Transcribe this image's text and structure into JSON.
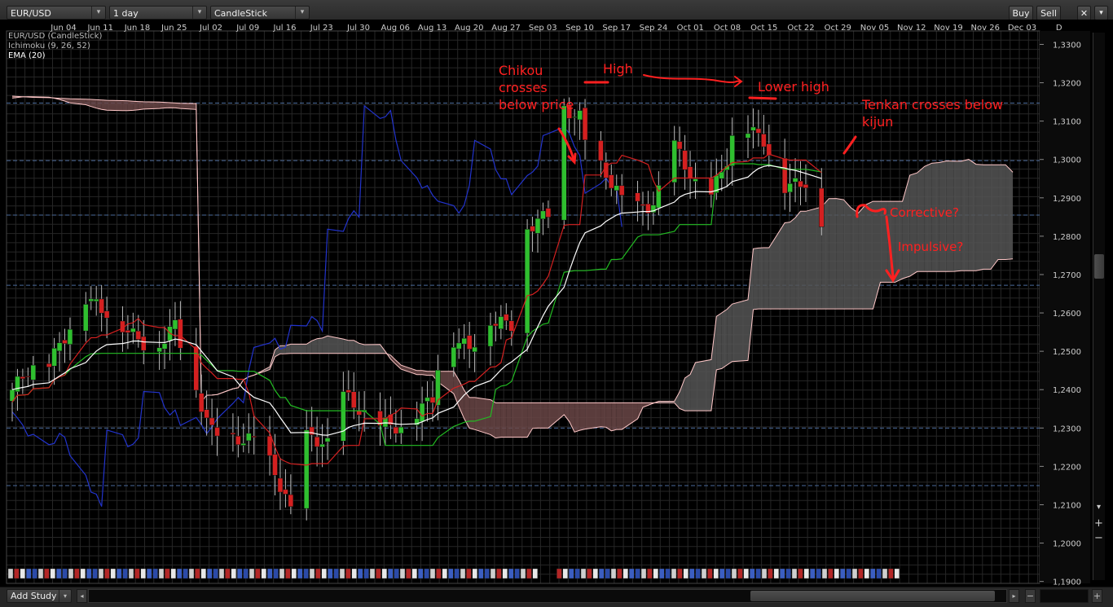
{
  "toolbar": {
    "symbol": "EUR/USD",
    "timeframe": "1 day",
    "chart_type": "CandleStick",
    "buy_label": "Buy",
    "sell_label": "Sell",
    "close_glyph": "✕",
    "dropdown_glyph": "▾"
  },
  "legend": {
    "line1": "EUR/USD (CandleStick)",
    "line2": "Ichimoku (9, 26, 52)",
    "line3": "EMA (20)"
  },
  "bottom": {
    "add_study": "Add Study",
    "dropdown_glyph": "▾",
    "left_glyph": "◂",
    "right_glyph": "▸",
    "zoom_out_glyph": "−",
    "zoom_in_glyph": "+"
  },
  "annotations": {
    "chikou": [
      "Chikou",
      "crosses",
      "below price"
    ],
    "high": "High",
    "lower_high": "Lower high",
    "tenkan": [
      "Tenkan crosses below",
      "kijun"
    ],
    "corrective": "Corrective?",
    "impulsive": "Impulsive?"
  },
  "colors": {
    "background": "#000000",
    "grid": "#262626",
    "bull_candle": "#2fbf2f",
    "bear_candle": "#d42020",
    "tenkan": "#d42020",
    "kijun": "#22bb22",
    "chikou": "#2233cc",
    "ema": "#ffffff",
    "kumo_bearish": "#6a4646",
    "kumo_bullish": "#555555",
    "annotation": "#ff2020"
  },
  "chart_data": {
    "type": "candlestick",
    "title": "EUR/USD (CandleStick)",
    "interval": "1 day",
    "x_tick_labels": [
      "Jun 04",
      "Jun 11",
      "Jun 18",
      "Jun 25",
      "Jul 02",
      "Jul 09",
      "Jul 16",
      "Jul 23",
      "Jul 30",
      "Aug 06",
      "Aug 13",
      "Aug 20",
      "Aug 27",
      "Sep 03",
      "Sep 10",
      "Sep 17",
      "Sep 24",
      "Oct 01",
      "Oct 08",
      "Oct 15",
      "Oct 22",
      "Oct 29",
      "Nov 05",
      "Nov 12",
      "Nov 19",
      "Nov 26",
      "Dec 03",
      "D"
    ],
    "y_tick_labels": [
      "1,3300",
      "1,3200",
      "1,3100",
      "1,3000",
      "1,2900",
      "1,2800",
      "1,2700",
      "1,2600",
      "1,2500",
      "1,2400",
      "1,2300",
      "1,2200",
      "1,2100",
      "1,2000",
      "1,1900"
    ],
    "ylim": [
      1.1895,
      1.3335
    ],
    "grid": true,
    "reference_lines": [
      1.3147,
      1.2997,
      1.2855,
      1.2672,
      1.23,
      1.215
    ],
    "key_closes": [
      {
        "x": "Jun 01",
        "y": 1.24
      },
      {
        "x": "Jun 04",
        "y": 1.245
      },
      {
        "x": "Jun 08",
        "y": 1.247
      },
      {
        "x": "Jun 12",
        "y": 1.256
      },
      {
        "x": "Jun 15",
        "y": 1.264
      },
      {
        "x": "Jun 20",
        "y": 1.259
      },
      {
        "x": "Jun 25",
        "y": 1.253
      },
      {
        "x": "Jun 28",
        "y": 1.25
      },
      {
        "x": "Jul 02",
        "y": 1.257
      },
      {
        "x": "Jul 05",
        "y": 1.243
      },
      {
        "x": "Jul 09",
        "y": 1.229
      },
      {
        "x": "Jul 13",
        "y": 1.227
      },
      {
        "x": "Jul 18",
        "y": 1.227
      },
      {
        "x": "Jul 23",
        "y": 1.212
      },
      {
        "x": "Jul 24",
        "y": 1.208
      },
      {
        "x": "Jul 27",
        "y": 1.228
      },
      {
        "x": "Aug 01",
        "y": 1.225
      },
      {
        "x": "Aug 03",
        "y": 1.239
      },
      {
        "x": "Aug 08",
        "y": 1.232
      },
      {
        "x": "Aug 14",
        "y": 1.23
      },
      {
        "x": "Aug 20",
        "y": 1.238
      },
      {
        "x": "Aug 22",
        "y": 1.254
      },
      {
        "x": "Aug 27",
        "y": 1.251
      },
      {
        "x": "Aug 31",
        "y": 1.258
      },
      {
        "x": "Sep 04",
        "y": 1.257
      },
      {
        "x": "Sep 06",
        "y": 1.263
      },
      {
        "x": "Sep 07",
        "y": 1.282
      },
      {
        "x": "Sep 11",
        "y": 1.286
      },
      {
        "x": "Sep 13",
        "y": 1.3
      },
      {
        "x": "Sep 14",
        "y": 1.313
      },
      {
        "x": "Sep 17",
        "y": 1.311
      },
      {
        "x": "Sep 18",
        "y": 1.305
      },
      {
        "x": "Sep 21",
        "y": 1.298
      },
      {
        "x": "Sep 24",
        "y": 1.292
      },
      {
        "x": "Sep 26",
        "y": 1.287
      },
      {
        "x": "Oct 01",
        "y": 1.288
      },
      {
        "x": "Oct 03",
        "y": 1.295
      },
      {
        "x": "Oct 05",
        "y": 1.304
      },
      {
        "x": "Oct 08",
        "y": 1.296
      },
      {
        "x": "Oct 11",
        "y": 1.288
      },
      {
        "x": "Oct 15",
        "y": 1.3
      },
      {
        "x": "Oct 17",
        "y": 1.311
      },
      {
        "x": "Oct 19",
        "y": 1.308
      },
      {
        "x": "Oct 22",
        "y": 1.305
      },
      {
        "x": "Oct 24",
        "y": 1.298
      },
      {
        "x": "Oct 26",
        "y": 1.293
      },
      {
        "x": "Oct 30",
        "y": 1.294
      },
      {
        "x": "Oct 31",
        "y": 1.298
      },
      {
        "x": "Nov 02",
        "y": 1.284
      }
    ],
    "series": [
      {
        "name": "Ichimoku (9, 26, 52)"
      },
      {
        "name": "EMA (20)"
      }
    ]
  }
}
